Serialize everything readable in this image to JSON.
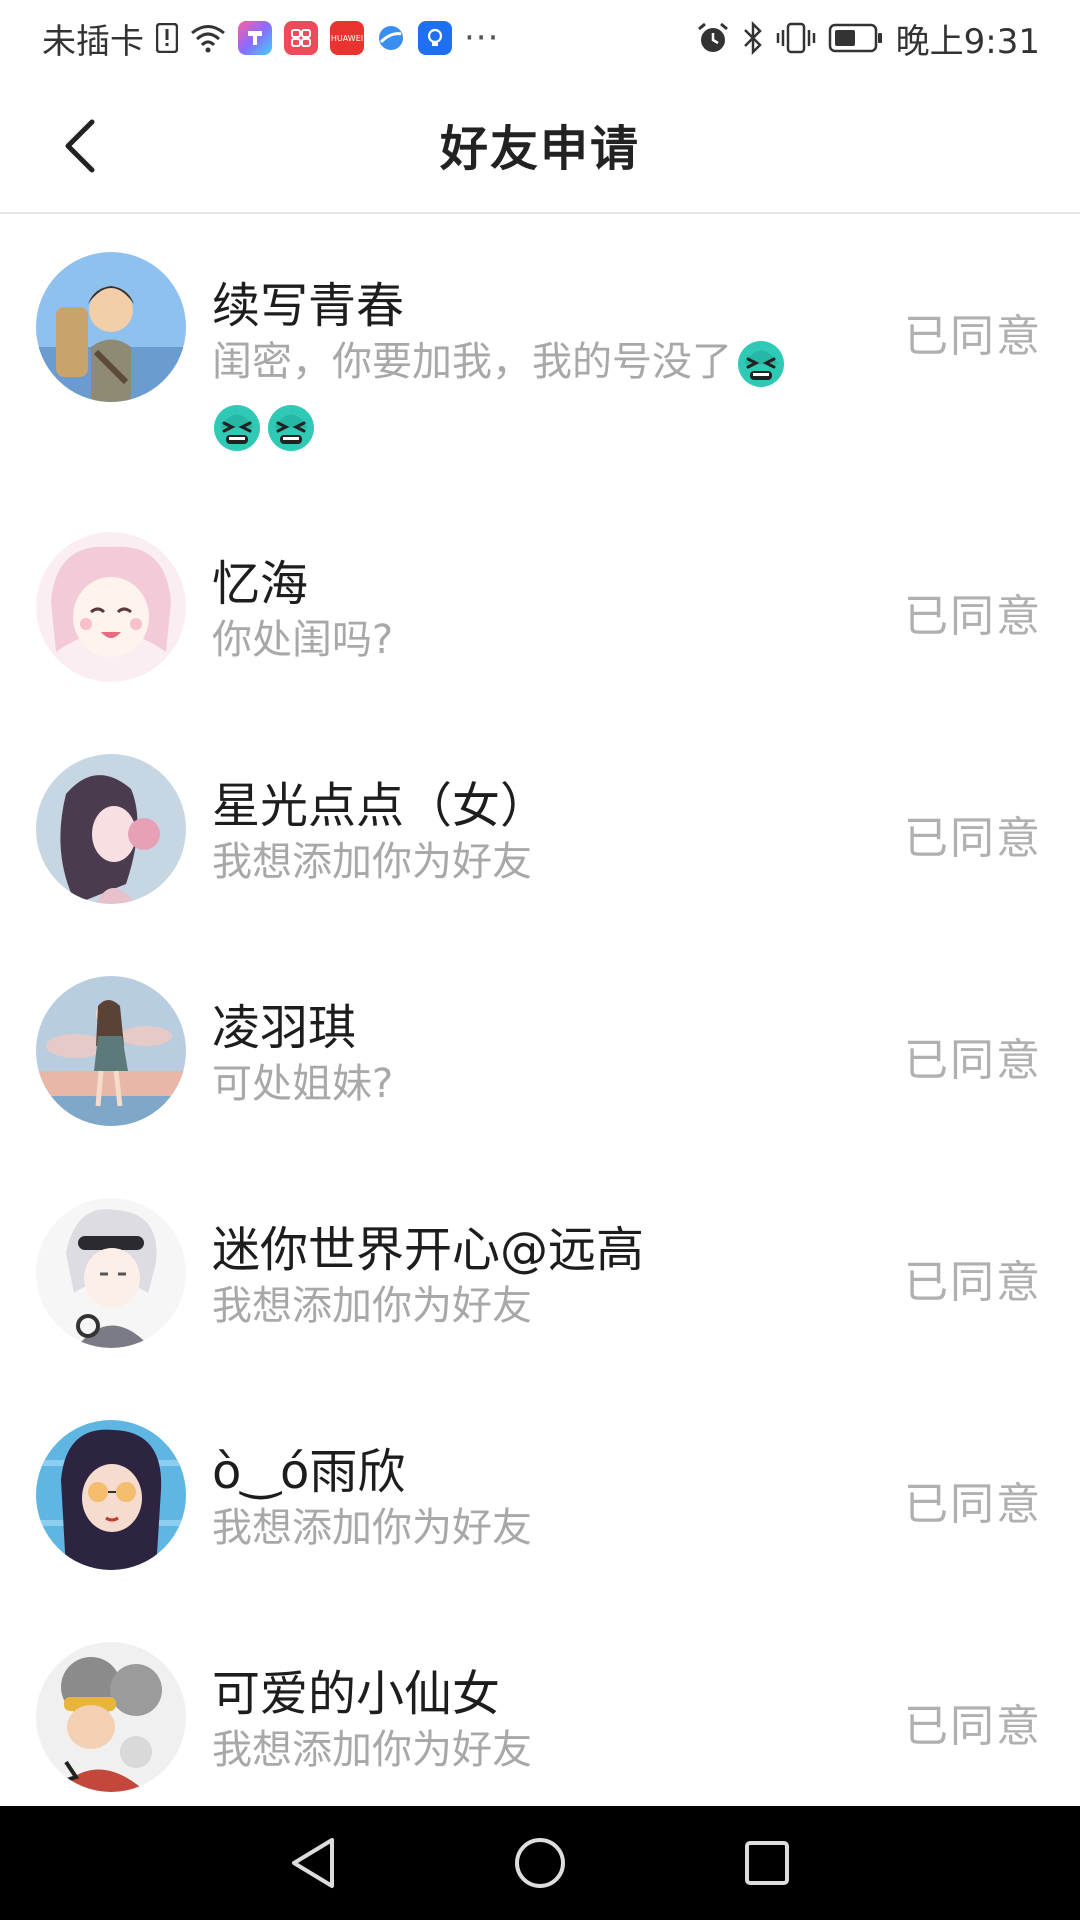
{
  "status_bar": {
    "carrier": "未插卡",
    "time": "晚上9:31",
    "icons_left": [
      "sim-alert-icon",
      "wifi-icon",
      "app-icon-1",
      "app-icon-2",
      "huawei-app-icon",
      "browser-icon",
      "app-icon-bulb"
    ],
    "icons_right": [
      "alarm-icon",
      "bluetooth-icon",
      "vibrate-icon",
      "battery-icon"
    ],
    "more": "···",
    "huawei_label": "HUAWEI"
  },
  "header": {
    "title": "好友申请"
  },
  "requests": [
    {
      "name": "续写青春",
      "message": "闺密，你要加我，我的号没了",
      "status": "已同意",
      "emoji_count": 3,
      "avatar_colors": [
        "#7fb3e8",
        "#c9a36b"
      ]
    },
    {
      "name": "忆海",
      "message": "你处闺吗?",
      "status": "已同意",
      "avatar_colors": [
        "#f6d6e0",
        "#fbeef2"
      ]
    },
    {
      "name": "星光点点（女）",
      "message": "我想添加你为好友",
      "status": "已同意",
      "avatar_colors": [
        "#c6d6e3",
        "#e7a1b6"
      ]
    },
    {
      "name": "凌羽琪",
      "message": "可处姐妹?",
      "status": "已同意",
      "avatar_colors": [
        "#b9cde0",
        "#e9b7a8"
      ]
    },
    {
      "name": "迷你世界开心@远高",
      "message": "我想添加你为好友",
      "status": "已同意",
      "avatar_colors": [
        "#ececec",
        "#7b7b88"
      ]
    },
    {
      "name": "ò‿ó雨欣",
      "message": "我想添加你为好友",
      "status": "已同意",
      "avatar_colors": [
        "#5fb6e3",
        "#2c2440"
      ]
    },
    {
      "name": "可爱的小仙女",
      "message": "我想添加你为好友",
      "status": "已同意",
      "avatar_colors": [
        "#d9d9d9",
        "#c4473b"
      ]
    }
  ],
  "nav_bar": {
    "icons": [
      "back-triangle-icon",
      "home-circle-icon",
      "recents-square-icon"
    ]
  }
}
